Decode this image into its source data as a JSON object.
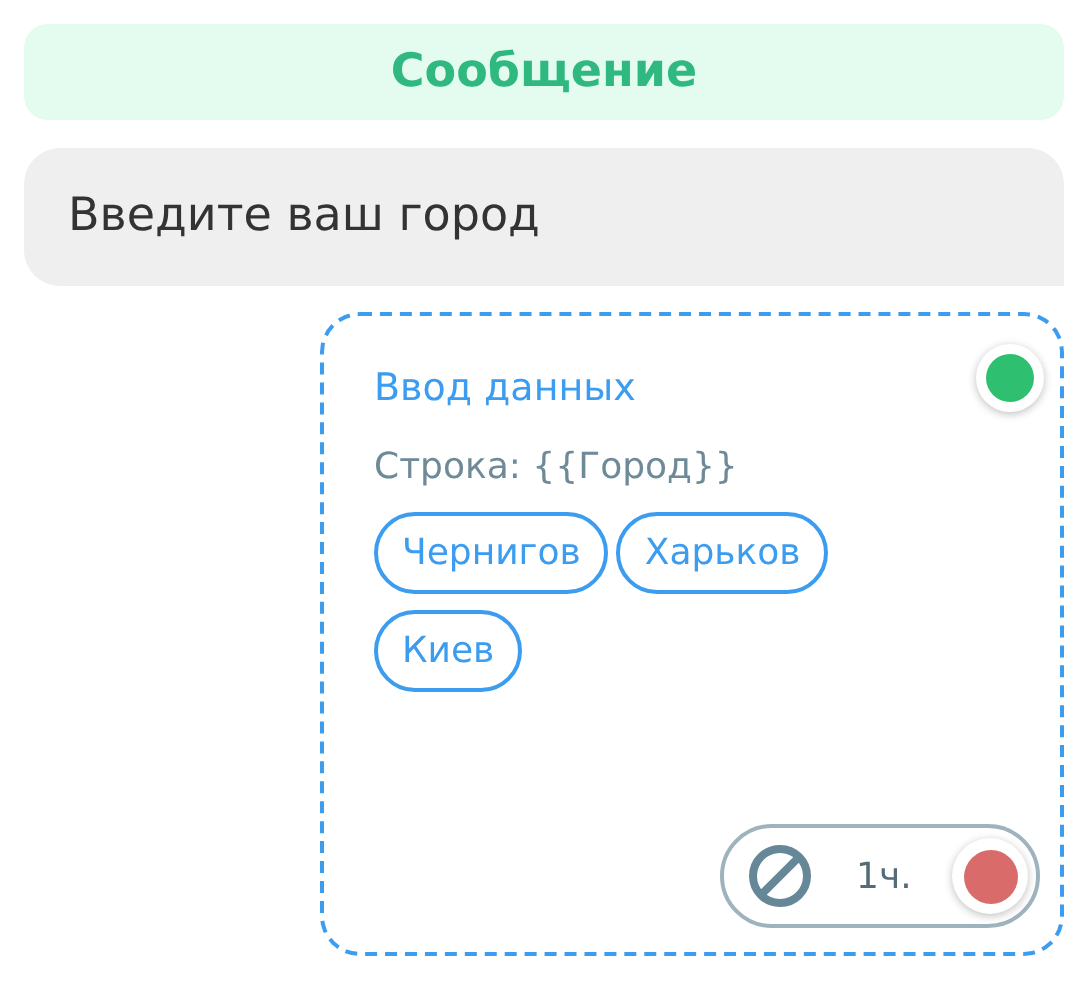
{
  "header": {
    "title": "Сообщение"
  },
  "message": {
    "text": "Введите ваш город"
  },
  "card": {
    "title": "Ввод данных",
    "variable": "Строка: {{Город}}",
    "color": "#2fbf71",
    "options": [
      {
        "label": "Чернигов"
      },
      {
        "label": "Харьков"
      },
      {
        "label": "Киев"
      }
    ],
    "timeout": {
      "label": "1ч.",
      "color": "#d96b6b"
    }
  }
}
